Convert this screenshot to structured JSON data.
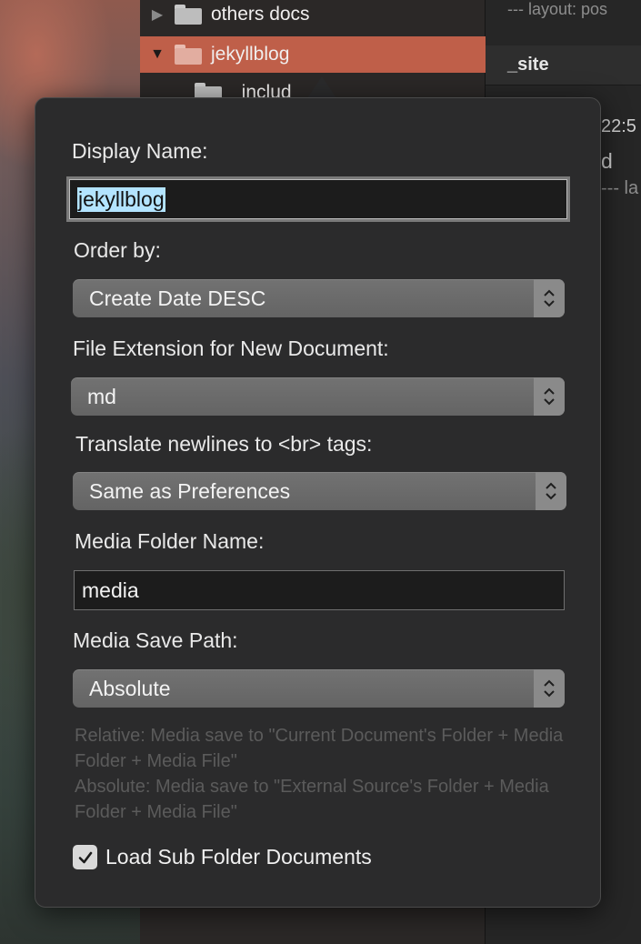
{
  "sidebar": {
    "items": [
      {
        "label": "others docs",
        "expanded": false,
        "selected": false
      },
      {
        "label": "jekyllblog",
        "expanded": true,
        "selected": true
      },
      {
        "label": "_includ"
      }
    ]
  },
  "editor": {
    "top_text": "--- layout: pos",
    "header": "_site",
    "fragments": [
      "22:5",
      "d",
      "--- la"
    ]
  },
  "popover": {
    "display_name": {
      "label": "Display Name:",
      "value": "jekyllblog"
    },
    "order_by": {
      "label": "Order by:",
      "value": "Create Date DESC"
    },
    "file_extension": {
      "label": "File Extension for New Document:",
      "value": "md"
    },
    "translate_newlines": {
      "label": "Translate newlines to <br> tags:",
      "value": "Same as Preferences"
    },
    "media_folder_name": {
      "label": "Media Folder Name:",
      "value": "media"
    },
    "media_save_path": {
      "label": "Media Save Path:",
      "value": "Absolute"
    },
    "help": [
      "Relative: Media save to \"Current Document's Folder + Media Folder + Media File\"",
      "Absolute: Media save to \"External Source's Folder + Media Folder + Media File\""
    ],
    "load_sub_folder": {
      "label": "Load Sub Folder Documents",
      "checked": true
    }
  },
  "colors": {
    "selection_row": "#bf5f49",
    "popover_bg": "#2b2b2c",
    "text_selection": "#b3e4ff"
  }
}
